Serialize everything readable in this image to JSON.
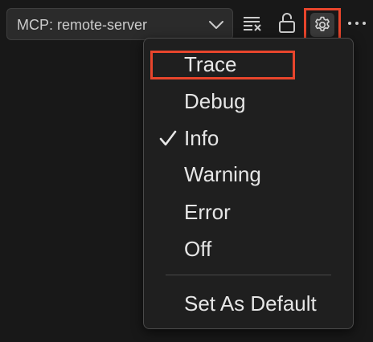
{
  "toolbar": {
    "channel_selector": {
      "selected": "MCP: remote-server"
    },
    "icons": {
      "clear_output": "clear-output-icon",
      "lock": "unlock-icon",
      "settings": "gear-icon",
      "more": "more-actions-icon",
      "chevron": "chevron-down-icon"
    }
  },
  "log_level_menu": {
    "items": [
      {
        "label": "Trace",
        "checked": false,
        "highlighted": true
      },
      {
        "label": "Debug",
        "checked": false
      },
      {
        "label": "Info",
        "checked": true
      },
      {
        "label": "Warning",
        "checked": false
      },
      {
        "label": "Error",
        "checked": false
      },
      {
        "label": "Off",
        "checked": false
      }
    ],
    "set_default_label": "Set As Default"
  },
  "colors": {
    "background": "#181818",
    "menu_background": "#1f1f1f",
    "menu_border": "#4a4a4a",
    "text": "#e6e6e6",
    "annotation_red": "#e8452c"
  }
}
